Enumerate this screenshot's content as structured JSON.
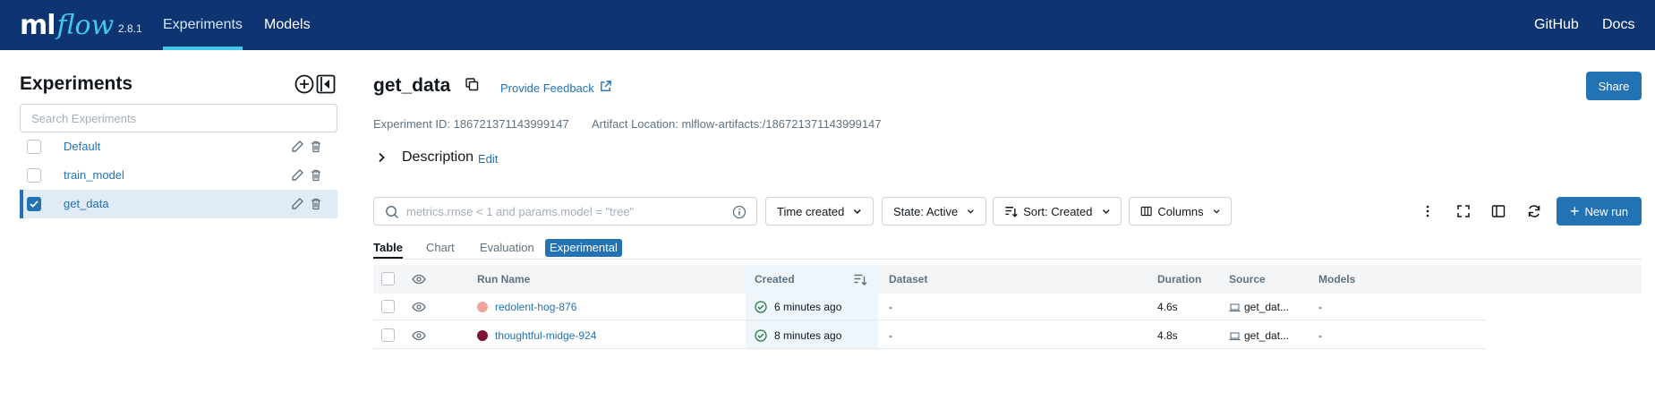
{
  "header": {
    "logo_ml": "ml",
    "logo_flow": "flow",
    "version": "2.8.1",
    "nav": [
      "Experiments",
      "Models"
    ],
    "right_links": [
      "GitHub",
      "Docs"
    ],
    "accent": "#43c9ed",
    "bg": "#0e3472"
  },
  "sidebar": {
    "title": "Experiments",
    "search_placeholder": "Search Experiments",
    "items": [
      {
        "label": "Default",
        "selected": false
      },
      {
        "label": "train_model",
        "selected": false
      },
      {
        "label": "get_data",
        "selected": true
      }
    ]
  },
  "main": {
    "title": "get_data",
    "feedback": "Provide Feedback",
    "share": "Share",
    "experiment_id": "Experiment ID: 186721371143999147",
    "artifact_location": "Artifact Location: mlflow-artifacts:/186721371143999147",
    "description": "Description",
    "description_edit": "Edit"
  },
  "toolbar": {
    "search_placeholder": "metrics.rmse < 1 and params.model = \"tree\"",
    "time_created": "Time created",
    "state": "State: Active",
    "sort": "Sort: Created",
    "columns": "Columns",
    "new_run": "New run"
  },
  "tabs": {
    "table": "Table",
    "chart": "Chart",
    "evaluation": "Evaluation",
    "badge": "Experimental"
  },
  "table": {
    "headers": {
      "run_name": "Run Name",
      "created": "Created",
      "dataset": "Dataset",
      "duration": "Duration",
      "source": "Source",
      "models": "Models"
    },
    "rows": [
      {
        "name": "redolent-hog-876",
        "color": "#f0a39b",
        "created": "6 minutes ago",
        "dataset": "-",
        "duration": "4.6s",
        "source": "get_dat...",
        "models": "-"
      },
      {
        "name": "thoughtful-midge-924",
        "color": "#7a1535",
        "created": "8 minutes ago",
        "dataset": "-",
        "duration": "4.8s",
        "source": "get_dat...",
        "models": "-"
      }
    ]
  }
}
